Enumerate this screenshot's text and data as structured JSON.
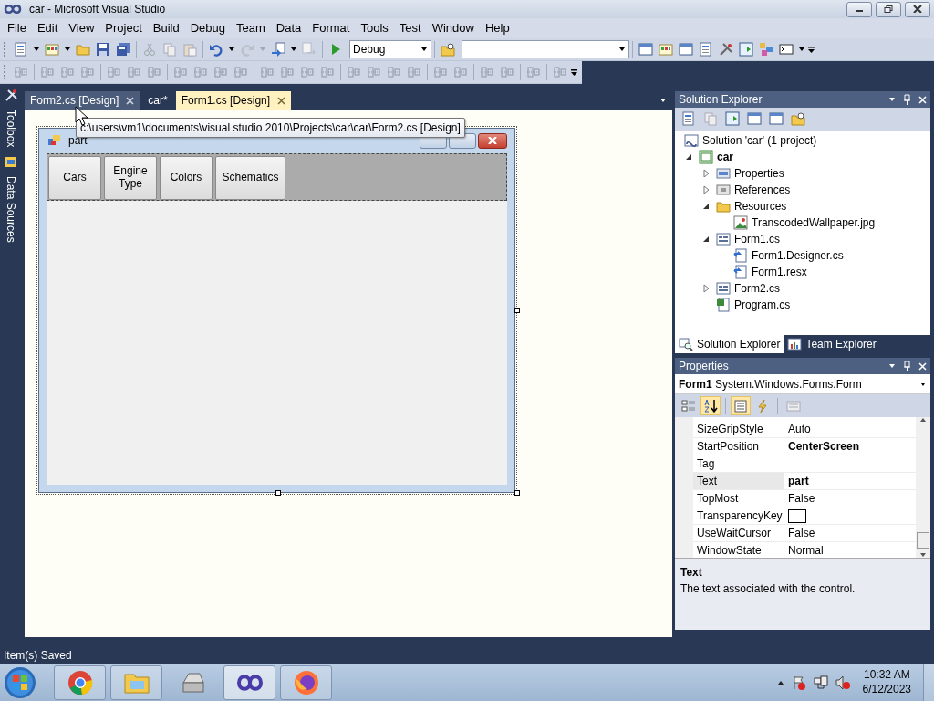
{
  "window": {
    "title": "car - Microsoft Visual Studio"
  },
  "menu": [
    "File",
    "Edit",
    "View",
    "Project",
    "Build",
    "Debug",
    "Team",
    "Data",
    "Format",
    "Tools",
    "Test",
    "Window",
    "Help"
  ],
  "toolbar": {
    "configuration": "Debug"
  },
  "side_tabs": [
    {
      "label": "Toolbox"
    },
    {
      "label": "Data Sources"
    }
  ],
  "document_tabs": [
    {
      "label": "Form2.cs [Design]",
      "selected": false,
      "hovered": true
    },
    {
      "label": "car*",
      "selected": false,
      "hovered": false
    },
    {
      "label": "Form1.cs [Design]",
      "selected": true,
      "hovered": false
    }
  ],
  "tooltip": "c:\\users\\vm1\\documents\\visual studio 2010\\Projects\\car\\car\\Form2.cs [Design]",
  "designer_form": {
    "title": "part",
    "buttons": [
      "Cars",
      "Engine Type",
      "Colors",
      "Schematics"
    ]
  },
  "solution_explorer": {
    "title": "Solution Explorer",
    "tree": [
      {
        "label": "Solution 'car' (1 project)",
        "kind": "solution",
        "children": [
          {
            "label": "car",
            "kind": "project",
            "expanded": true,
            "children": [
              {
                "label": "Properties",
                "kind": "properties",
                "expanded": false
              },
              {
                "label": "References",
                "kind": "references",
                "expanded": false
              },
              {
                "label": "Resources",
                "kind": "folder",
                "expanded": true,
                "children": [
                  {
                    "label": "TranscodedWallpaper.jpg",
                    "kind": "image"
                  }
                ]
              },
              {
                "label": "Form1.cs",
                "kind": "form",
                "expanded": true,
                "children": [
                  {
                    "label": "Form1.Designer.cs",
                    "kind": "code"
                  },
                  {
                    "label": "Form1.resx",
                    "kind": "code"
                  }
                ]
              },
              {
                "label": "Form2.cs",
                "kind": "form",
                "expanded": false
              },
              {
                "label": "Program.cs",
                "kind": "csharp"
              }
            ]
          }
        ]
      }
    ],
    "tabs": [
      {
        "label": "Solution Explorer",
        "selected": true
      },
      {
        "label": "Team Explorer",
        "selected": false
      }
    ]
  },
  "properties": {
    "title": "Properties",
    "object": "**Form1** System.Windows.Forms.Form",
    "toggles": [
      {
        "selected": false
      },
      {
        "selected": true
      },
      {
        "selected": true
      },
      {
        "selected": false
      }
    ],
    "rows": [
      {
        "name": "SizeGripStyle",
        "kind": "text",
        "value": "Auto",
        "modified": false,
        "selected": false
      },
      {
        "name": "StartPosition",
        "kind": "text",
        "value": "CenterScreen",
        "modified": true,
        "selected": false
      },
      {
        "name": "Tag",
        "kind": "text",
        "selected": false
      },
      {
        "name": "Text",
        "kind": "text",
        "value": "part",
        "modified": true,
        "selected": true
      },
      {
        "name": "TopMost",
        "kind": "text",
        "value": "False",
        "modified": false,
        "selected": false
      },
      {
        "name": "TransparencyKey",
        "kind": "color",
        "selected": false
      },
      {
        "name": "UseWaitCursor",
        "kind": "text",
        "value": "False",
        "modified": false,
        "selected": false
      },
      {
        "name": "WindowState",
        "kind": "text",
        "value": "Normal",
        "modified": false,
        "selected": false
      }
    ],
    "description": {
      "title": "Text",
      "text": "The text associated with the control."
    }
  },
  "status_bar": "Item(s) Saved",
  "taskbar": {
    "apps": [
      {
        "running": true,
        "selected": false
      },
      {
        "running": true,
        "selected": false
      },
      {
        "running": false,
        "selected": false
      },
      {
        "running": true,
        "selected": true
      },
      {
        "running": true,
        "selected": false
      }
    ],
    "time": "10:32 AM",
    "date": "6/12/2023"
  }
}
